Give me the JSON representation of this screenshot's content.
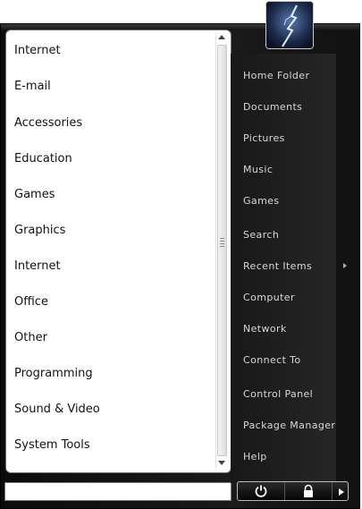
{
  "applications": [
    "Internet",
    "E-mail",
    "Accessories",
    "Education",
    "Games",
    "Graphics",
    "Internet",
    "Office",
    "Other",
    "Programming",
    "Sound & Video",
    "System Tools"
  ],
  "places": [
    "Home Folder",
    "Documents",
    "Pictures",
    "Music",
    "Games",
    "Search",
    "Recent Items",
    "Computer",
    "Network",
    "Connect To",
    "Control Panel",
    "Package Manager",
    "Help"
  ],
  "search": {
    "value": ""
  },
  "icons": {
    "avatar": "lightning-avatar-icon",
    "power": "power-icon",
    "lock": "lock-icon",
    "more": "chevron-right-icon"
  },
  "colors": {
    "menu_background": "#111111",
    "place_text": "#d8d8d8",
    "app_text": "#111111"
  }
}
